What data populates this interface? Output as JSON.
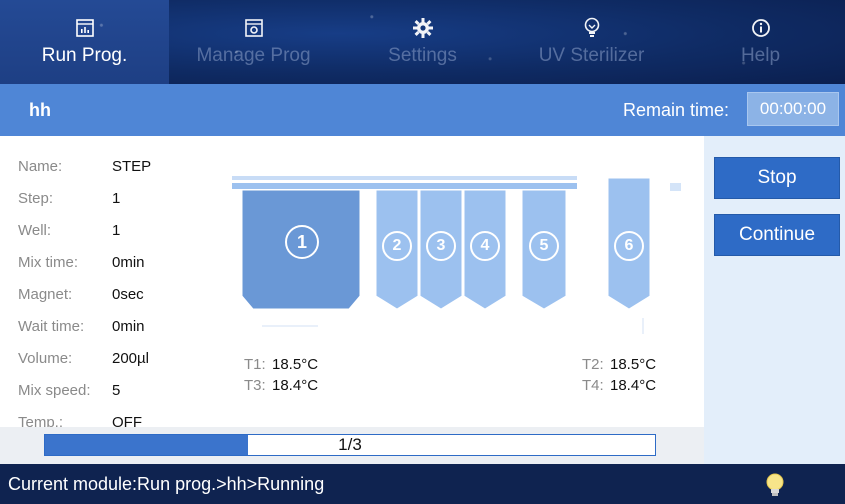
{
  "nav": {
    "tabs": [
      {
        "label": "Run Prog.",
        "icon": "chart-icon",
        "active": true
      },
      {
        "label": "Manage Prog",
        "icon": "program-icon",
        "active": false
      },
      {
        "label": "Settings",
        "icon": "gear-icon",
        "active": false
      },
      {
        "label": "UV Sterilizer",
        "icon": "bulb-icon",
        "active": false
      },
      {
        "label": "Help",
        "icon": "info-icon",
        "active": false
      }
    ]
  },
  "titlebar": {
    "program_name": "hh",
    "remain_label": "Remain time:",
    "remain_value": "00:00:00"
  },
  "info": {
    "rows": [
      {
        "label": "Name:",
        "value": "STEP"
      },
      {
        "label": "Step:",
        "value": "1"
      },
      {
        "label": "Well:",
        "value": "1"
      },
      {
        "label": "Mix time:",
        "value": "0min"
      },
      {
        "label": "Magnet:",
        "value": "0sec"
      },
      {
        "label": "Wait time:",
        "value": "0min"
      },
      {
        "label": "Volume:",
        "value": "200µl"
      },
      {
        "label": "Mix speed:",
        "value": "5"
      },
      {
        "label": "Temp.:",
        "value": "OFF"
      }
    ]
  },
  "wells": {
    "labels": [
      "1",
      "2",
      "3",
      "4",
      "5",
      "6"
    ],
    "active_well": "1"
  },
  "temps": {
    "t1_label": "T1:",
    "t1_value": "18.5°C",
    "t3_label": "T3:",
    "t3_value": "18.4°C",
    "t2_label": "T2:",
    "t2_value": "18.5°C",
    "t4_label": "T4:",
    "t4_value": "18.4°C"
  },
  "actions": {
    "stop_label": "Stop",
    "continue_label": "Continue"
  },
  "progress": {
    "label": "1/3",
    "fraction": 0.333
  },
  "status": {
    "text": "Current module:Run prog.>hh>Running"
  },
  "colors": {
    "nav_bg": "#0f2b64",
    "titlebar_bg": "#4f86d6",
    "button_bg": "#2e6bc6",
    "well_bg": "#9cc1ef",
    "well_active_bg": "#6a98d6"
  }
}
